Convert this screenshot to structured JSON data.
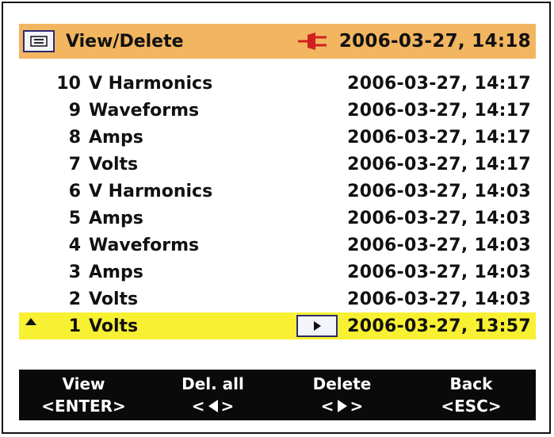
{
  "header": {
    "title": "View/Delete",
    "datetime": "2006-03-27, 14:18",
    "menu_icon": "menu-icon",
    "power_icon": "mains-plug-icon",
    "background_color": "#f2b560"
  },
  "records": [
    {
      "number": "10",
      "name": "V Harmonics",
      "timestamp": "2006-03-27, 14:17"
    },
    {
      "number": "9",
      "name": "Waveforms",
      "timestamp": "2006-03-27, 14:17"
    },
    {
      "number": "8",
      "name": "Amps",
      "timestamp": "2006-03-27, 14:17"
    },
    {
      "number": "7",
      "name": "Volts",
      "timestamp": "2006-03-27, 14:17"
    },
    {
      "number": "6",
      "name": "V Harmonics",
      "timestamp": "2006-03-27, 14:03"
    },
    {
      "number": "5",
      "name": "Amps",
      "timestamp": "2006-03-27, 14:03"
    },
    {
      "number": "4",
      "name": "Waveforms",
      "timestamp": "2006-03-27, 14:03"
    },
    {
      "number": "3",
      "name": "Amps",
      "timestamp": "2006-03-27, 14:03"
    },
    {
      "number": "2",
      "name": "Volts",
      "timestamp": "2006-03-27, 14:03"
    },
    {
      "number": "1",
      "name": "Volts",
      "timestamp": "2006-03-27, 13:57",
      "selected": true
    }
  ],
  "selection_color": "#f8f032",
  "footer": {
    "keys": [
      {
        "label": "View",
        "hint": "<ENTER>"
      },
      {
        "label": "Del. all",
        "hint_left": "<",
        "hint_icon": "left-arrow-icon",
        "hint_right": ">"
      },
      {
        "label": "Delete",
        "hint_left": "<",
        "hint_icon": "right-arrow-icon",
        "hint_right": ">"
      },
      {
        "label": "Back",
        "hint": "<ESC>"
      }
    ]
  }
}
